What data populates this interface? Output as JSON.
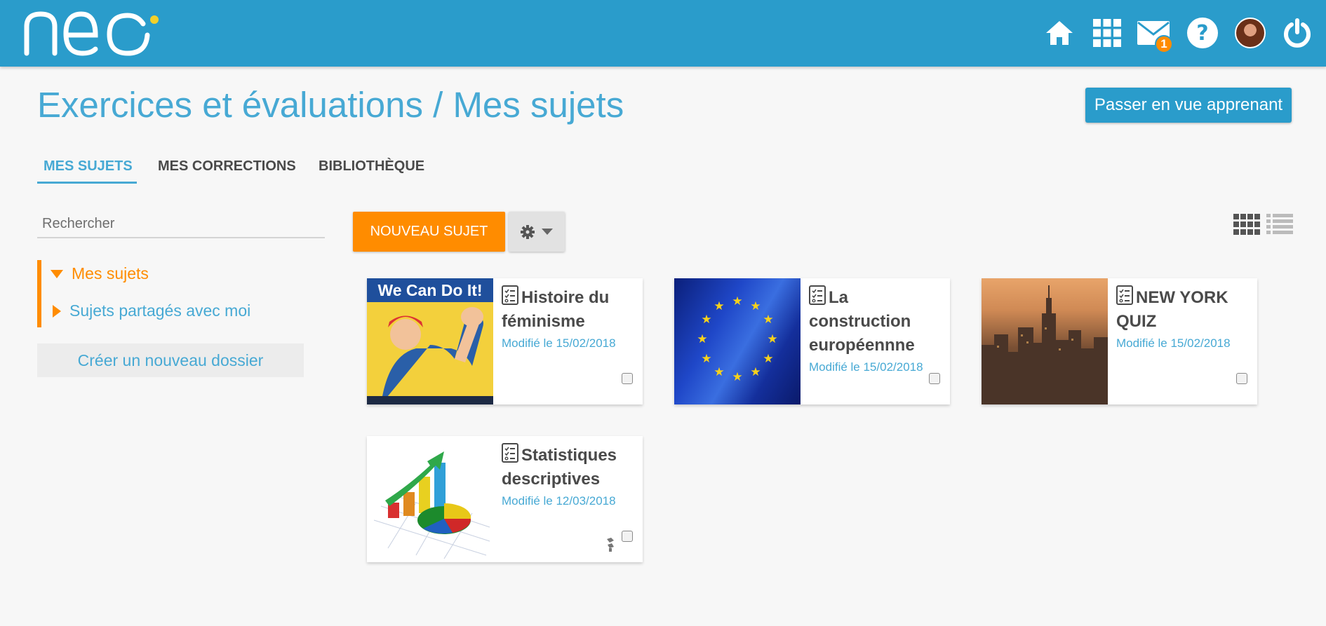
{
  "header": {
    "logo_text": "neo",
    "icons": [
      "home-icon",
      "apps-grid-icon",
      "mail-icon",
      "help-icon",
      "avatar",
      "power-icon"
    ],
    "mail_badge": "1",
    "colors": {
      "bar": "#2a9ccb",
      "badge": "#ff8c00"
    }
  },
  "page": {
    "title": "Exercices et évaluations / Mes sujets",
    "learner_view_button": "Passer en vue apprenant"
  },
  "tabs": [
    {
      "label": "MES SUJETS",
      "active": true
    },
    {
      "label": "MES CORRECTIONS",
      "active": false
    },
    {
      "label": "BIBLIOTHÈQUE",
      "active": false
    }
  ],
  "sidebar": {
    "search_placeholder": "Rechercher",
    "folders": [
      {
        "label": "Mes sujets",
        "expanded": true,
        "selected": true
      },
      {
        "label": "Sujets partagés avec moi",
        "expanded": false,
        "selected": false
      }
    ],
    "new_folder_button": "Créer un nouveau dossier"
  },
  "toolbar": {
    "new_subject_button": "NOUVEAU SUJET",
    "settings_icon": "gear-icon",
    "view_modes": [
      "grid-view-icon",
      "list-view-icon"
    ],
    "accent": "#ff8c00"
  },
  "subjects": [
    {
      "title": "Histoire du féminisme",
      "modified": "Modifié le 15/02/2018",
      "thumb": "we-can-do-it-poster",
      "thumb_text": "We Can Do It!",
      "shared": false
    },
    {
      "title": "La construction européennne",
      "modified": "Modifié le 15/02/2018",
      "thumb": "eu-flag",
      "shared": false
    },
    {
      "title": "NEW YORK QUIZ",
      "modified": "Modifié le 15/02/2018",
      "thumb": "new-york-skyline",
      "shared": false
    },
    {
      "title": "Statistiques descriptives",
      "modified": "Modifié le 12/03/2018",
      "thumb": "statistics-chart",
      "shared": true
    }
  ]
}
